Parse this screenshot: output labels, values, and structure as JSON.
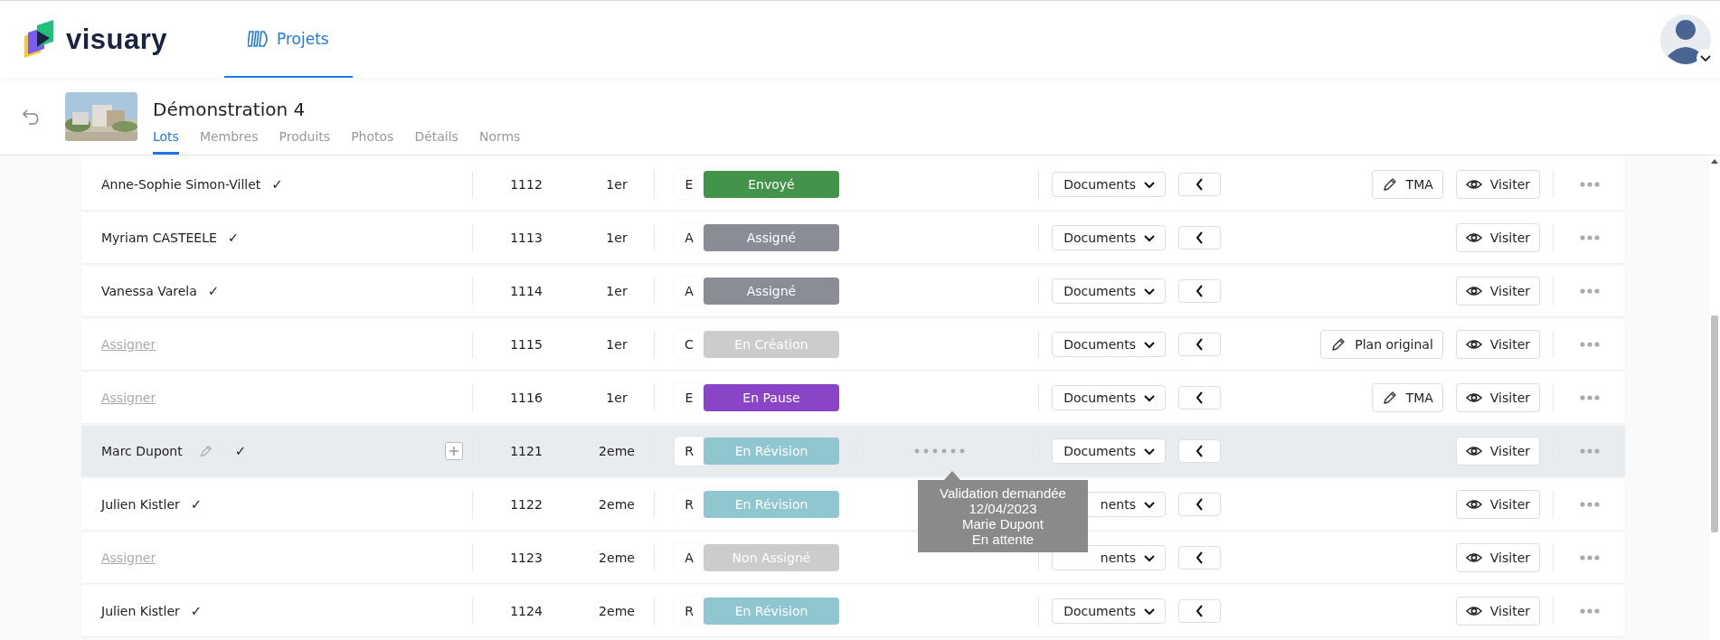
{
  "header": {
    "logo_text": "visuary",
    "nav": [
      {
        "label": "Projets",
        "selected": true
      }
    ]
  },
  "project": {
    "title": "Démonstration 4",
    "tabs": [
      {
        "label": "Lots",
        "selected": true
      },
      {
        "label": "Membres",
        "selected": false
      },
      {
        "label": "Produits",
        "selected": false
      },
      {
        "label": "Photos",
        "selected": false
      },
      {
        "label": "Détails",
        "selected": false
      },
      {
        "label": "Norms",
        "selected": false
      }
    ]
  },
  "rows": [
    {
      "kind": "assigned",
      "name": "Anne-Sophie Simon-Villet",
      "mark": "✓",
      "selected": false,
      "number": "1112",
      "floor": "1er",
      "letter": "E",
      "status": "Envoyé",
      "color": "#43944a",
      "documents": "Documents",
      "buttons": [
        {
          "kind": "edit",
          "label": "TMA"
        },
        {
          "kind": "view",
          "label": "Visiter"
        }
      ]
    },
    {
      "kind": "assigned",
      "name": "Myriam CASTEELE",
      "mark": "✓",
      "selected": false,
      "number": "1113",
      "floor": "1er",
      "letter": "A",
      "status": "Assigné",
      "color": "#8a8d96",
      "documents": "Documents",
      "buttons": [
        {
          "kind": "view",
          "label": "Visiter"
        }
      ]
    },
    {
      "kind": "assigned",
      "name": "Vanessa Varela",
      "mark": "✓",
      "selected": false,
      "number": "1114",
      "floor": "1er",
      "letter": "A",
      "status": "Assigné",
      "color": "#8a8d96",
      "documents": "Documents",
      "buttons": [
        {
          "kind": "view",
          "label": "Visiter"
        }
      ]
    },
    {
      "kind": "unassigned",
      "name": "Assigner",
      "selected": false,
      "number": "1115",
      "floor": "1er",
      "letter": "C",
      "status": "En Création",
      "color": "#cccccc",
      "documents": "Documents",
      "buttons": [
        {
          "kind": "edit",
          "label": "Plan original"
        },
        {
          "kind": "view",
          "label": "Visiter"
        }
      ]
    },
    {
      "kind": "unassigned",
      "name": "Assigner",
      "selected": false,
      "number": "1116",
      "floor": "1er",
      "letter": "E",
      "status": "En Pause",
      "color": "#8a44c8",
      "documents": "Documents",
      "buttons": [
        {
          "kind": "edit",
          "label": "TMA"
        },
        {
          "kind": "view",
          "label": "Visiter"
        }
      ]
    },
    {
      "kind": "assigned",
      "name": "Marc Dupont",
      "mark": "✓",
      "selected": true,
      "number": "1121",
      "floor": "2eme",
      "letter": "R",
      "status": "En Révision",
      "color": "#8fc6cf",
      "validation": {
        "tooltip": [
          "Validation demandée",
          "12/04/2023",
          "Marie Dupont",
          "En attente"
        ]
      },
      "documents": "Documents",
      "buttons": [
        {
          "kind": "view",
          "label": "Visiter"
        }
      ]
    },
    {
      "kind": "assigned",
      "name": "Julien Kistler",
      "mark": "✓",
      "selected": false,
      "number": "1122",
      "floor": "2eme",
      "letter": "R",
      "status": "En Révision",
      "color": "#8fc6cf",
      "documents": "nents",
      "buttons": [
        {
          "kind": "view",
          "label": "Visiter"
        }
      ]
    },
    {
      "kind": "unassigned",
      "name": "Assigner",
      "selected": false,
      "number": "1123",
      "floor": "2eme",
      "letter": "A",
      "status": "Non Assigné",
      "color": "#cccccc",
      "documents": "nents",
      "buttons": [
        {
          "kind": "view",
          "label": "Visiter"
        }
      ]
    },
    {
      "kind": "assigned",
      "name": "Julien Kistler",
      "mark": "✓",
      "selected": false,
      "number": "1124",
      "floor": "2eme",
      "letter": "R",
      "status": "En Révision",
      "color": "#8fc6cf",
      "documents": "Documents",
      "buttons": [
        {
          "kind": "view",
          "label": "Visiter"
        }
      ]
    }
  ]
}
